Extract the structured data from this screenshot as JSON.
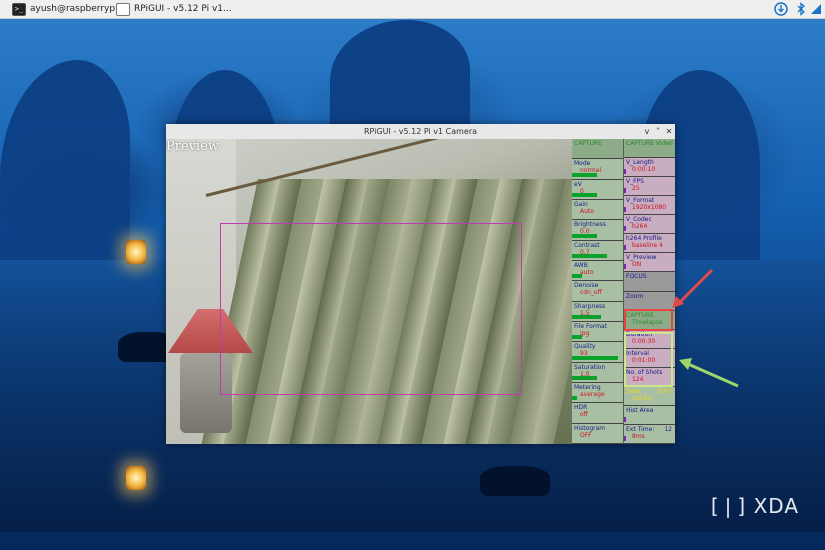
{
  "taskbar": {
    "terminal_icon_glyph": ">_",
    "terminal_label": "ayush@raspberrypi: ~",
    "rpigui_label": "RPiGUI - v5.12  Pi v1...",
    "system_icons": [
      "update-icon",
      "bluetooth-icon",
      "network-icon",
      "volume-icon"
    ]
  },
  "window": {
    "title": "RPiGUI - v5.12  Pi v1 Camera",
    "minimize": "v",
    "maximize": "˄",
    "close": "✕"
  },
  "preview": {
    "label": "Preview"
  },
  "left_controls": [
    {
      "label": "CAPTURE",
      "value": "",
      "slider": 0
    },
    {
      "label": "Mode",
      "value": "normal",
      "slider": 0.5
    },
    {
      "label": "eV",
      "value": "0",
      "slider": 0.5
    },
    {
      "label": "Gain",
      "value": "Auto",
      "slider": 0
    },
    {
      "label": "Brightness",
      "value": "0.0",
      "slider": 0.5
    },
    {
      "label": "Contrast",
      "value": "0.7",
      "slider": 0.72
    },
    {
      "label": "AWB",
      "value": "auto",
      "slider": 0.2
    },
    {
      "label": "Denoise",
      "value": "cdn_off",
      "slider": 0
    },
    {
      "label": "Sharpness",
      "value": "1.5",
      "slider": 0.6
    },
    {
      "label": "File Format",
      "value": "jpg",
      "slider": 0.2
    },
    {
      "label": "Quality",
      "value": "93",
      "slider": 0.93
    },
    {
      "label": "Saturation",
      "value": "1.0",
      "slider": 0.5
    },
    {
      "label": "Metering",
      "value": "average",
      "slider": 0.1
    },
    {
      "label": "HDR",
      "value": "off",
      "slider": 0
    },
    {
      "label": "Histogram",
      "value": "OFF",
      "slider": 0
    }
  ],
  "right_controls": [
    {
      "label": "CAPTURE Video",
      "value": "",
      "kind": "action"
    },
    {
      "label": "V_Length",
      "value": "0:00:10",
      "kind": "param"
    },
    {
      "label": "V_FPS",
      "value": "25",
      "kind": "param"
    },
    {
      "label": "V_Format",
      "value": "1920x1080",
      "kind": "param"
    },
    {
      "label": "V_Codec",
      "value": "h264",
      "kind": "param"
    },
    {
      "label": "h264 Profile",
      "value": "baseline 4",
      "kind": "param"
    },
    {
      "label": "V_Preview",
      "value": "ON",
      "kind": "param"
    },
    {
      "label": "FOCUS",
      "value": "",
      "kind": "plain"
    },
    {
      "label": "Zoom",
      "value": "",
      "kind": "plain"
    },
    {
      "label": "CAPTURE",
      "value": "Timelapse",
      "kind": "action"
    },
    {
      "label": "Duration",
      "value": "0:00:30",
      "kind": "param"
    },
    {
      "label": "Interval",
      "value": "0:01:00",
      "kind": "param"
    },
    {
      "label": "No. of Shots",
      "value": "124",
      "kind": "param"
    },
    {
      "label": "Save",
      "value": "Config",
      "extra": "EXIT",
      "kind": "save"
    },
    {
      "label": "Hist Area",
      "value": "",
      "kind": "param"
    },
    {
      "label": "Ext Time:",
      "value": "8ms",
      "extra": "12",
      "kind": "param"
    }
  ],
  "watermark": {
    "brand": "XDA"
  },
  "colors": {
    "panel_green": "#a9bfa3",
    "panel_pink": "#c9adc0",
    "label_blue": "#1a1a8a",
    "value_red": "#c9141e",
    "slider_green": "#0aa22a",
    "highlight_red": "#e84545",
    "highlight_green": "#c8e88a"
  }
}
